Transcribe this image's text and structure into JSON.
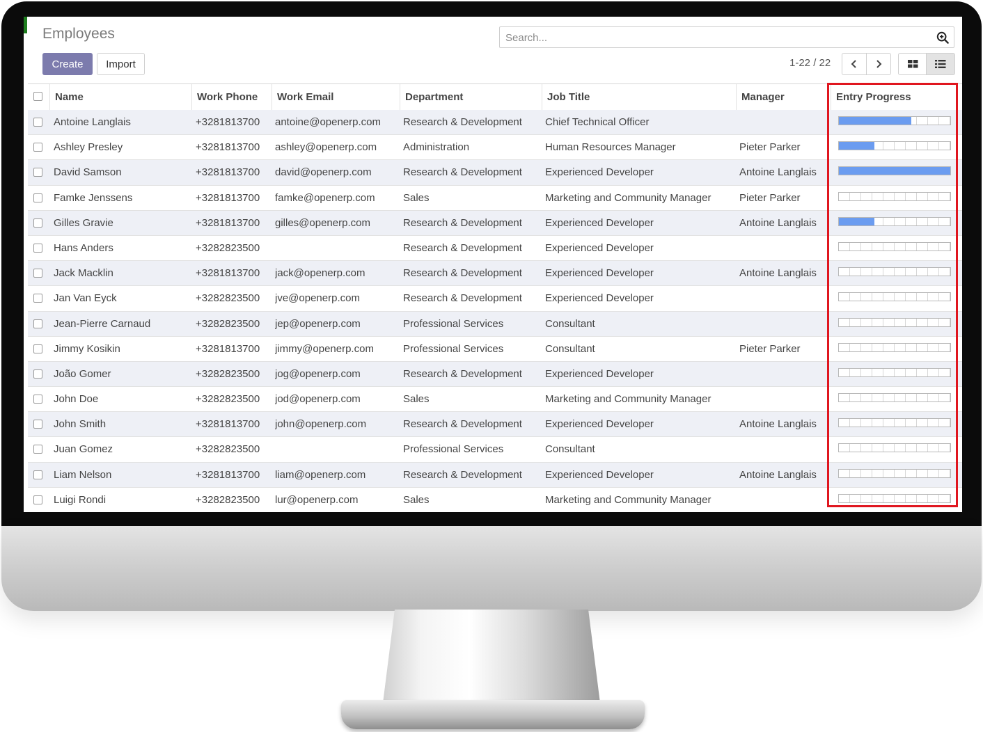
{
  "app": {
    "title": "Employees",
    "search_placeholder": "Search...",
    "create_label": "Create",
    "import_label": "Import",
    "pager": "1-22 / 22"
  },
  "icons": {
    "search": "search-plus-icon",
    "prev": "chevron-left-icon",
    "next": "chevron-right-icon",
    "kanban": "grid-view-icon",
    "list": "list-view-icon"
  },
  "colors": {
    "primary": "#7c7bad",
    "progress_fill": "#6b9cf0",
    "highlight": "#e0161f"
  },
  "columns": [
    "Name",
    "Work Phone",
    "Work Email",
    "Department",
    "Job Title",
    "Manager",
    "Entry Progress"
  ],
  "rows": [
    {
      "name": "Antoine Langlais",
      "phone": "+3281813700",
      "email": "antoine@openerp.com",
      "department": "Research & Development",
      "job": "Chief Technical Officer",
      "manager": "",
      "progress": 65
    },
    {
      "name": "Ashley Presley",
      "phone": "+3281813700",
      "email": "ashley@openerp.com",
      "department": "Administration",
      "job": "Human Resources Manager",
      "manager": "Pieter Parker",
      "progress": 32
    },
    {
      "name": "David Samson",
      "phone": "+3281813700",
      "email": "david@openerp.com",
      "department": "Research & Development",
      "job": "Experienced Developer",
      "manager": "Antoine Langlais",
      "progress": 100
    },
    {
      "name": "Famke Jenssens",
      "phone": "+3281813700",
      "email": "famke@openerp.com",
      "department": "Sales",
      "job": "Marketing and Community Manager",
      "manager": "Pieter Parker",
      "progress": 0
    },
    {
      "name": "Gilles Gravie",
      "phone": "+3281813700",
      "email": "gilles@openerp.com",
      "department": "Research & Development",
      "job": "Experienced Developer",
      "manager": "Antoine Langlais",
      "progress": 32
    },
    {
      "name": "Hans Anders",
      "phone": "+3282823500",
      "email": "",
      "department": "Research & Development",
      "job": "Experienced Developer",
      "manager": "",
      "progress": 0
    },
    {
      "name": "Jack Macklin",
      "phone": "+3281813700",
      "email": "jack@openerp.com",
      "department": "Research & Development",
      "job": "Experienced Developer",
      "manager": "Antoine Langlais",
      "progress": 0
    },
    {
      "name": "Jan Van Eyck",
      "phone": "+3282823500",
      "email": "jve@openerp.com",
      "department": "Research & Development",
      "job": "Experienced Developer",
      "manager": "",
      "progress": 0
    },
    {
      "name": "Jean-Pierre Carnaud",
      "phone": "+3282823500",
      "email": "jep@openerp.com",
      "department": "Professional Services",
      "job": "Consultant",
      "manager": "",
      "progress": 0
    },
    {
      "name": "Jimmy Kosikin",
      "phone": "+3281813700",
      "email": "jimmy@openerp.com",
      "department": "Professional Services",
      "job": "Consultant",
      "manager": "Pieter Parker",
      "progress": 0
    },
    {
      "name": "João Gomer",
      "phone": "+3282823500",
      "email": "jog@openerp.com",
      "department": "Research & Development",
      "job": "Experienced Developer",
      "manager": "",
      "progress": 0
    },
    {
      "name": "John Doe",
      "phone": "+3282823500",
      "email": "jod@openerp.com",
      "department": "Sales",
      "job": "Marketing and Community Manager",
      "manager": "",
      "progress": 0
    },
    {
      "name": "John Smith",
      "phone": "+3281813700",
      "email": "john@openerp.com",
      "department": "Research & Development",
      "job": "Experienced Developer",
      "manager": "Antoine Langlais",
      "progress": 0
    },
    {
      "name": "Juan Gomez",
      "phone": "+3282823500",
      "email": "",
      "department": "Professional Services",
      "job": "Consultant",
      "manager": "",
      "progress": 0
    },
    {
      "name": "Liam Nelson",
      "phone": "+3281813700",
      "email": "liam@openerp.com",
      "department": "Research & Development",
      "job": "Experienced Developer",
      "manager": "Antoine Langlais",
      "progress": 0
    },
    {
      "name": "Luigi Rondi",
      "phone": "+3282823500",
      "email": "lur@openerp.com",
      "department": "Sales",
      "job": "Marketing and Community Manager",
      "manager": "",
      "progress": 0
    }
  ]
}
